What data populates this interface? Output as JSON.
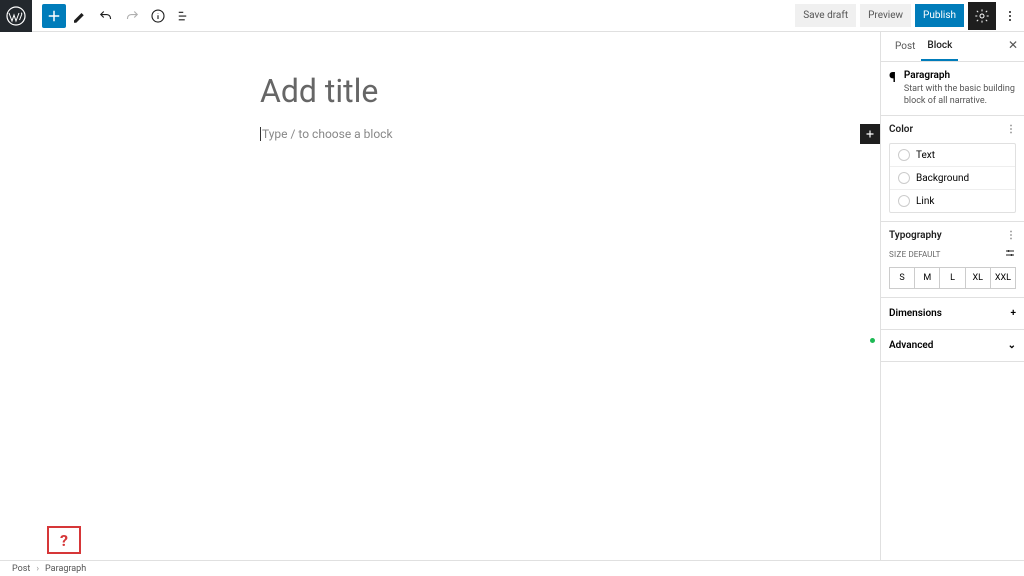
{
  "toolbar": {
    "save_draft": "Save draft",
    "preview": "Preview",
    "publish": "Publish"
  },
  "editor": {
    "title_placeholder": "Add title",
    "block_placeholder": "Type / to choose a block"
  },
  "sidebar": {
    "tabs": {
      "post": "Post",
      "block": "Block"
    },
    "block": {
      "name": "Paragraph",
      "description": "Start with the basic building block of all narrative."
    },
    "color": {
      "heading": "Color",
      "items": [
        "Text",
        "Background",
        "Link"
      ]
    },
    "typography": {
      "heading": "Typography",
      "size_label": "SIZE",
      "size_default": "DEFAULT",
      "sizes": [
        "S",
        "M",
        "L",
        "XL",
        "XXL"
      ]
    },
    "dimensions": "Dimensions",
    "advanced": "Advanced"
  },
  "breadcrumb": {
    "post": "Post",
    "current": "Paragraph"
  },
  "help": "?"
}
